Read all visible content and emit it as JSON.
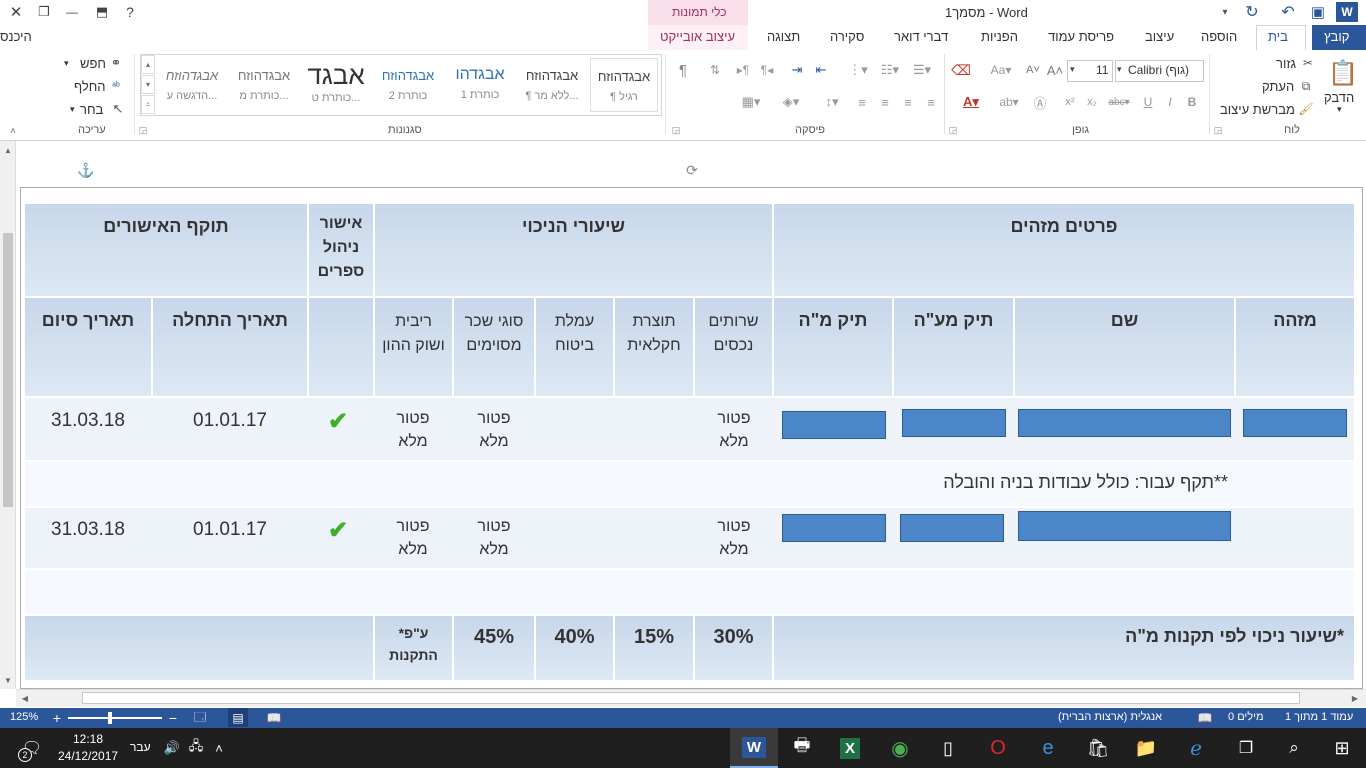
{
  "window": {
    "title": "מסמך1 - Word",
    "picture_tools": "כלי תמונות",
    "help": "?",
    "close": "✕",
    "restore": "❐",
    "minimize": "—"
  },
  "tabs": [
    "קובץ",
    "בית",
    "הוספה",
    "עיצוב",
    "פריסת עמוד",
    "הפניות",
    "דברי דואר",
    "סקירה",
    "תצוגה",
    "עיצוב אובייקט"
  ],
  "signin": "היכנס",
  "clipboard": {
    "paste": "הדבק",
    "cut": "גזור",
    "copy": "העתק",
    "format_painter": "מברשת עיצוב",
    "group": "לוח"
  },
  "font": {
    "name": "Calibri (גוף)",
    "size": "11",
    "group": "גופן"
  },
  "paragraph": {
    "group": "פיסקה"
  },
  "styles": {
    "group": "סגנונות",
    "items": [
      {
        "preview": "אבגדהוזח",
        "label": "¶ רגיל"
      },
      {
        "preview": "אבגדהוזח",
        "label": "¶ ללא מר..."
      },
      {
        "preview": "אבגדהו",
        "label": "כותרת 1"
      },
      {
        "preview": "אבגדהוזח",
        "label": "כותרת 2"
      },
      {
        "preview": "אבגד",
        "label": "כותרת ט..."
      },
      {
        "preview": "אבגדהוזח",
        "label": "כותרת מ..."
      },
      {
        "preview": "אבגדהוזח",
        "label": "הדגשה ע..."
      }
    ]
  },
  "editing": {
    "find": "חפש",
    "replace": "החלף",
    "select": "בחר",
    "group": "עריכה"
  },
  "table": {
    "h_identifiers": "פרטים מזהים",
    "h_rates": "שיעורי הניכוי",
    "h_approval": "אישור ניהול ספרים",
    "h_validity": "תוקף האישורים",
    "c_id": "מזהה",
    "c_name": "שם",
    "c_vat": "תיק מע\"ה",
    "c_tax": "תיק מ\"ה",
    "c_services": "שרותים נכסים",
    "c_agri": "תוצרת חקלאית",
    "c_insurance": "עמלת ביטוח",
    "c_wages": "סוגי שכר מסוימים",
    "c_interest": "ריבית ושוק ההון",
    "c_start": "תאריך התחלה",
    "c_end": "תאריך סיום",
    "row1": {
      "services": "פטור מלא",
      "wages": "פטור מלא",
      "interest": "פטור מלא",
      "start": "01.01.17",
      "end": "31.03.18"
    },
    "note": "**תקף עבור: כולל עבודות בניה והובלה",
    "row2": {
      "services": "פטור מלא",
      "wages": "פטור מלא",
      "interest": "פטור מלא",
      "start": "01.01.17",
      "end": "31.03.18"
    },
    "footer_label": "*שיעור ניכוי לפי תקנות מ\"ה",
    "footer_services": "30%",
    "footer_agri": "15%",
    "footer_insurance": "40%",
    "footer_wages": "45%",
    "footer_interest": "*ע\"פ התקנות"
  },
  "status": {
    "page": "עמוד 1 מתוך 1",
    "words": "0 מילים",
    "lang": "אנגלית (ארצות הברית)",
    "zoom": "125%"
  },
  "taskbar": {
    "time": "12:18",
    "date": "24/12/2017",
    "lang": "עבר",
    "notif": "2"
  }
}
